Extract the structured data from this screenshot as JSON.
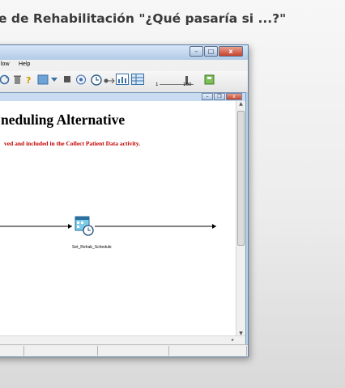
{
  "slide": {
    "title": "e de Rehabilitación \"¿Qué pasaría si ...?\""
  },
  "window": {
    "controls": {
      "minimize": "–",
      "maximize": "□",
      "close": "x"
    }
  },
  "menubar": {
    "items": [
      "low",
      "Help"
    ]
  },
  "toolbar": {
    "icons": [
      "refresh-icon",
      "trash-icon",
      "help-icon",
      "color-fill-icon",
      "dropdown-arrow-icon",
      "stop-icon",
      "animation-icon",
      "clock-icon",
      "connector-icon",
      "chart-icon",
      "table-icon",
      "save-icon"
    ],
    "slider": {
      "min": "1",
      "max": "100"
    }
  },
  "inner_window": {
    "controls": {
      "minimize": "–",
      "restore": "❐",
      "close": "x"
    }
  },
  "diagram": {
    "title": "neduling Alternative",
    "note": "ved and included in the Collect Patient Data activity.",
    "node": {
      "label": "Set_Rehab_Schedule"
    }
  }
}
